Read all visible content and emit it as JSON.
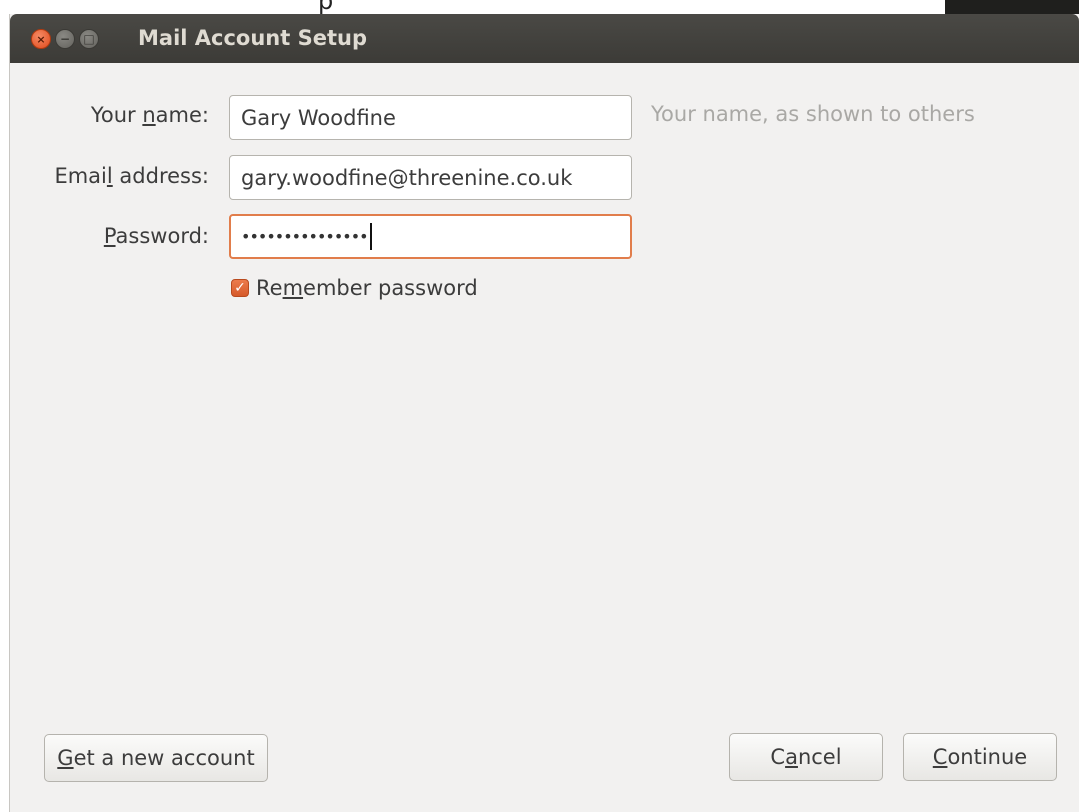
{
  "background_window": {
    "title_fragment": "p"
  },
  "window": {
    "title": "Mail Account Setup",
    "controls": {
      "close": "×",
      "minimize": "−",
      "maximize": "□"
    }
  },
  "form": {
    "name": {
      "label_pre": "Your ",
      "label_key": "n",
      "label_post": "ame:",
      "value": "Gary Woodfine",
      "hint": "Your name, as shown to others"
    },
    "email": {
      "label_pre": "Emai",
      "label_key": "l",
      "label_post": " address:",
      "value": "gary.woodfine@threenine.co.uk"
    },
    "password": {
      "label_pre": "",
      "label_key": "P",
      "label_post": "assword:",
      "value": "•••••••••••••••"
    },
    "remember": {
      "checked": true,
      "check_glyph": "✓",
      "label_pre": "Re",
      "label_key": "m",
      "label_post": "ember password"
    }
  },
  "buttons": {
    "get_new_account": {
      "label_pre": "",
      "label_key": "G",
      "label_post": "et a new account"
    },
    "cancel": {
      "label_pre": "C",
      "label_key": "a",
      "label_post": "ncel"
    },
    "continue": {
      "label_pre": "",
      "label_key": "C",
      "label_post": "ontinue"
    }
  },
  "colors": {
    "titlebar": "#3c3b37",
    "accent": "#e17d4b",
    "window_bg": "#f2f1f0"
  }
}
